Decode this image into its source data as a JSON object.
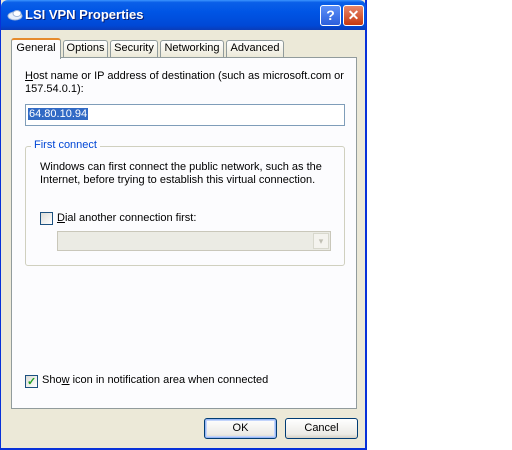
{
  "window": {
    "title": "LSI VPN Properties",
    "help_label": "?",
    "close_label": "✕"
  },
  "tabs": [
    {
      "label": "General",
      "active": true
    },
    {
      "label": "Options",
      "active": false
    },
    {
      "label": "Security",
      "active": false
    },
    {
      "label": "Networking",
      "active": false
    },
    {
      "label": "Advanced",
      "active": false
    }
  ],
  "general": {
    "host_label_first_char": "H",
    "host_label_rest": "ost name or IP address of destination (such as microsoft.com or",
    "host_label_line2": "157.54.0.1):",
    "host_value": "64.80.10.94",
    "first_connect": {
      "title": "First connect",
      "desc_line1": "Windows can first connect the public network, such as the",
      "desc_line2": "Internet, before trying to establish this virtual connection.",
      "dial_checkbox_checked": false,
      "dial_label_first_char": "D",
      "dial_label_rest": "ial another connection first:",
      "connection_select_value": ""
    },
    "show_icon_checked": true,
    "show_icon_before": "Sho",
    "show_icon_underlined": "w",
    "show_icon_after": " icon in notification area when connected"
  },
  "buttons": {
    "ok": "OK",
    "cancel": "Cancel"
  },
  "icons": {
    "title_icon": "network-connection-icon",
    "checkmark": "✓",
    "dropdown": "▾"
  },
  "colors": {
    "titlebar": "#0055e5",
    "face": "#ece9d8",
    "selection": "#316ac5",
    "group_title": "#0046d5",
    "active_tab_accent": "#e68b2c"
  }
}
